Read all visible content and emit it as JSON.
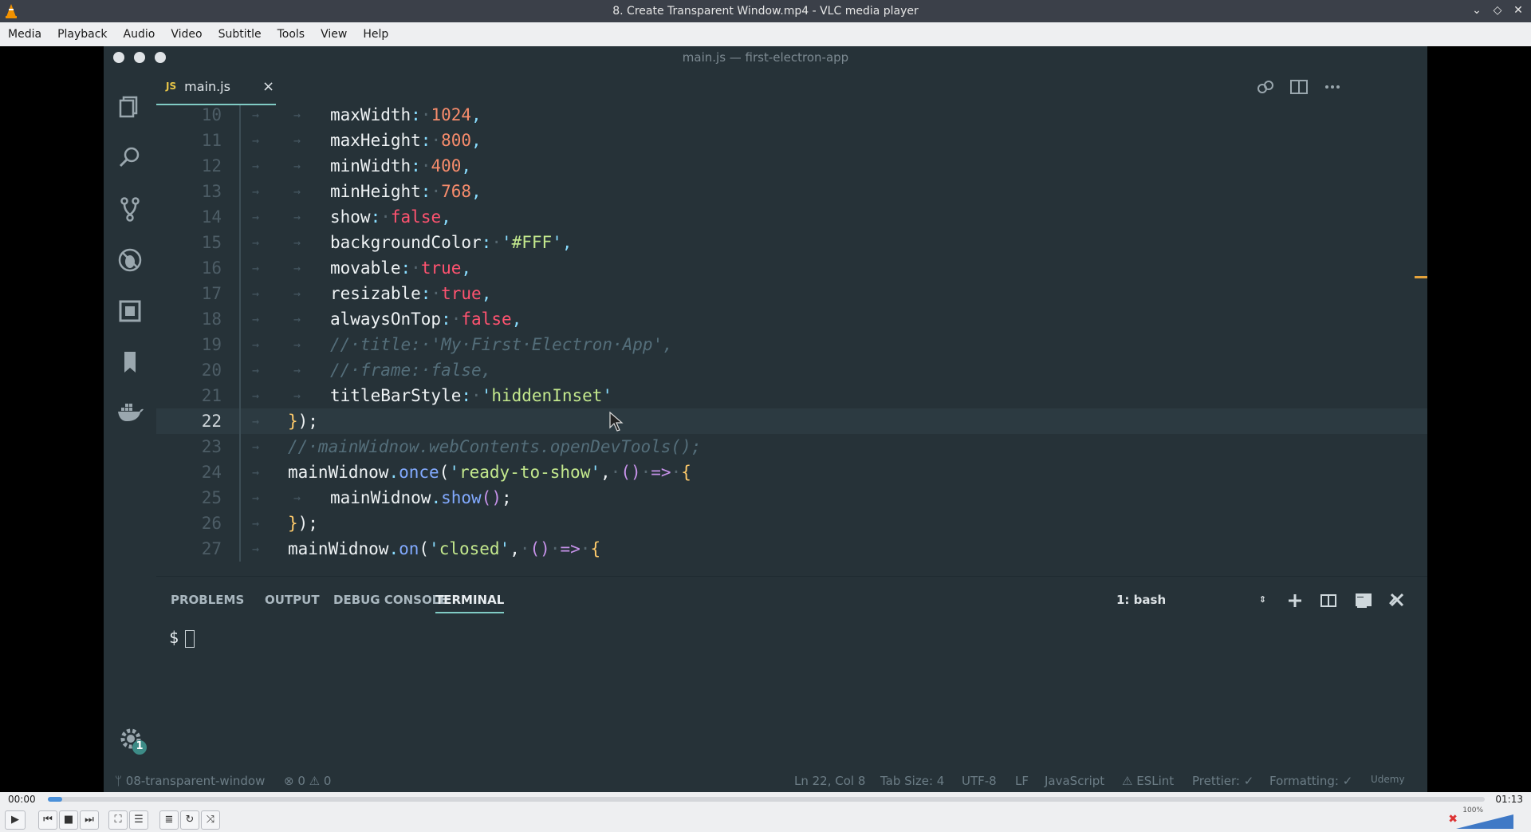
{
  "window": {
    "title": "8. Create Transparent Window.mp4 - VLC media player"
  },
  "menu": [
    "Media",
    "Playback",
    "Audio",
    "Video",
    "Subtitle",
    "Tools",
    "View",
    "Help"
  ],
  "editor": {
    "title": "main.js — first-electron-app",
    "tab": {
      "badge": "JS",
      "name": "main.js",
      "close": "×"
    },
    "current_line": 22
  },
  "code_lines": [
    {
      "n": "10",
      "indent": 2,
      "tokens": [
        [
          "k",
          "maxWidth"
        ],
        [
          "p",
          ":"
        ],
        [
          "dot",
          "·"
        ],
        [
          "n",
          "1024"
        ],
        [
          "p",
          ","
        ]
      ]
    },
    {
      "n": "11",
      "indent": 2,
      "tokens": [
        [
          "k",
          "maxHeight"
        ],
        [
          "p",
          ":"
        ],
        [
          "dot",
          "·"
        ],
        [
          "n",
          "800"
        ],
        [
          "p",
          ","
        ]
      ]
    },
    {
      "n": "12",
      "indent": 2,
      "tokens": [
        [
          "k",
          "minWidth"
        ],
        [
          "p",
          ":"
        ],
        [
          "dot",
          "·"
        ],
        [
          "n",
          "400"
        ],
        [
          "p",
          ","
        ]
      ]
    },
    {
      "n": "13",
      "indent": 2,
      "tokens": [
        [
          "k",
          "minHeight"
        ],
        [
          "p",
          ":"
        ],
        [
          "dot",
          "·"
        ],
        [
          "n",
          "768"
        ],
        [
          "p",
          ","
        ]
      ]
    },
    {
      "n": "14",
      "indent": 2,
      "tokens": [
        [
          "k",
          "show"
        ],
        [
          "p",
          ":"
        ],
        [
          "dot",
          "·"
        ],
        [
          "b",
          "false"
        ],
        [
          "p",
          ","
        ]
      ]
    },
    {
      "n": "15",
      "indent": 2,
      "tokens": [
        [
          "k",
          "backgroundColor"
        ],
        [
          "p",
          ":"
        ],
        [
          "dot",
          "·"
        ],
        [
          "p",
          "'"
        ],
        [
          "s",
          "#FFF"
        ],
        [
          "p",
          "'"
        ],
        [
          "p",
          ","
        ]
      ]
    },
    {
      "n": "16",
      "indent": 2,
      "tokens": [
        [
          "k",
          "movable"
        ],
        [
          "p",
          ":"
        ],
        [
          "dot",
          "·"
        ],
        [
          "b",
          "true"
        ],
        [
          "p",
          ","
        ]
      ]
    },
    {
      "n": "17",
      "indent": 2,
      "tokens": [
        [
          "k",
          "resizable"
        ],
        [
          "p",
          ":"
        ],
        [
          "dot",
          "·"
        ],
        [
          "b",
          "true"
        ],
        [
          "p",
          ","
        ]
      ]
    },
    {
      "n": "18",
      "indent": 2,
      "tokens": [
        [
          "k",
          "alwaysOnTop"
        ],
        [
          "p",
          ":"
        ],
        [
          "dot",
          "·"
        ],
        [
          "b",
          "false"
        ],
        [
          "p",
          ","
        ]
      ]
    },
    {
      "n": "19",
      "indent": 2,
      "tokens": [
        [
          "c",
          "//·title:·'My·First·Electron·App',"
        ]
      ]
    },
    {
      "n": "20",
      "indent": 2,
      "tokens": [
        [
          "c",
          "//·frame:·false,"
        ]
      ]
    },
    {
      "n": "21",
      "indent": 2,
      "tokens": [
        [
          "k",
          "titleBarStyle"
        ],
        [
          "p",
          ":"
        ],
        [
          "dot",
          "·"
        ],
        [
          "p",
          "'"
        ],
        [
          "s",
          "hiddenInset"
        ],
        [
          "p",
          "'"
        ]
      ]
    },
    {
      "n": "22",
      "indent": 1,
      "tokens": [
        [
          "y",
          "}"
        ],
        [
          "w",
          ");"
        ]
      ]
    },
    {
      "n": "23",
      "indent": 1,
      "tokens": [
        [
          "c",
          "//·mainWidnow.webContents.openDevTools();"
        ]
      ]
    },
    {
      "n": "24",
      "indent": 1,
      "tokens": [
        [
          "w",
          "mainWidnow"
        ],
        [
          "p",
          "."
        ],
        [
          "f",
          "once"
        ],
        [
          "w",
          "("
        ],
        [
          "p",
          "'"
        ],
        [
          "s",
          "ready-to-show"
        ],
        [
          "p",
          "'"
        ],
        [
          "w",
          ","
        ],
        [
          "dot",
          "·"
        ],
        [
          "kw",
          "()"
        ],
        [
          "dot",
          "·"
        ],
        [
          "kw",
          "=>"
        ],
        [
          "dot",
          "·"
        ],
        [
          "y",
          "{"
        ]
      ]
    },
    {
      "n": "25",
      "indent": 2,
      "tokens": [
        [
          "w",
          "mainWidnow"
        ],
        [
          "p",
          "."
        ],
        [
          "f",
          "show"
        ],
        [
          "kw",
          "()"
        ],
        [
          "w",
          ";"
        ]
      ]
    },
    {
      "n": "26",
      "indent": 1,
      "tokens": [
        [
          "y",
          "}"
        ],
        [
          "w",
          ");"
        ]
      ]
    },
    {
      "n": "27",
      "indent": 1,
      "tokens": [
        [
          "w",
          "mainWidnow"
        ],
        [
          "p",
          "."
        ],
        [
          "f",
          "on"
        ],
        [
          "w",
          "("
        ],
        [
          "p",
          "'"
        ],
        [
          "s",
          "closed"
        ],
        [
          "p",
          "'"
        ],
        [
          "w",
          ","
        ],
        [
          "dot",
          "·"
        ],
        [
          "kw",
          "()"
        ],
        [
          "dot",
          "·"
        ],
        [
          "kw",
          "=>"
        ],
        [
          "dot",
          "·"
        ],
        [
          "y",
          "{"
        ]
      ]
    }
  ],
  "panel": {
    "tabs": [
      "PROBLEMS",
      "OUTPUT",
      "DEBUG CONSOLE",
      "TERMINAL"
    ],
    "active_tab": "TERMINAL",
    "terminal_select": "1: bash",
    "prompt": "$"
  },
  "settings_badge": "1",
  "statusbar": {
    "branch": "08-transparent-window",
    "errors": "0",
    "warnings": "0",
    "position": "Ln 22, Col 8",
    "tab_size": "Tab Size: 4",
    "encoding": "UTF-8",
    "eol": "LF",
    "language": "JavaScript",
    "eslint": "ESLint",
    "prettier": "Prettier: ✓",
    "formatting": "Formatting: ✓",
    "watermark": "Udemy"
  },
  "player": {
    "time_elapsed": "00:00",
    "time_total": "01:13",
    "progress": 0.01,
    "volume": "100%"
  },
  "colors": {
    "accent": "#80cbc4",
    "editor_bg": "#263238",
    "vlc_bar": "#eeeff1"
  }
}
